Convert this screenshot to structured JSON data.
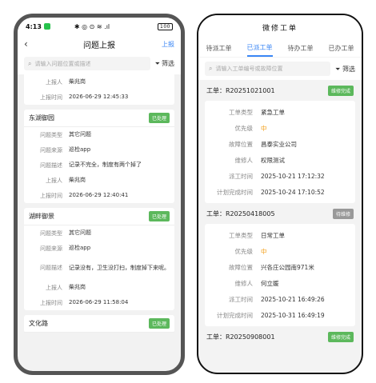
{
  "left": {
    "status": {
      "time": "4:13",
      "right": "✱ ◎ ⊙ ≋ .ıl",
      "battery": "100"
    },
    "nav": {
      "title": "问题上报",
      "action": "上报"
    },
    "search": {
      "placeholder": "请输入问题位置或描述",
      "filter": "筛选"
    },
    "top_partial": {
      "rows": [
        {
          "k": "上报人",
          "v": "柴兆岗"
        },
        {
          "k": "上报时间",
          "v": "2026-06-29 12:45:33"
        }
      ]
    },
    "cards": [
      {
        "name": "东湖御园",
        "status": "已处理",
        "rows": [
          {
            "k": "问题类型",
            "v": "其它问题"
          },
          {
            "k": "问题来源",
            "v": "巡检app"
          },
          {
            "k": "问题描述",
            "v": "记录不完全，制度有两个掉了"
          },
          {
            "k": "上报人",
            "v": "柴兆岗"
          },
          {
            "k": "上报时间",
            "v": "2026-06-29 12:40:41"
          }
        ]
      },
      {
        "name": "湖畔御景",
        "status": "已处理",
        "rows": [
          {
            "k": "问题类型",
            "v": "其它问题"
          },
          {
            "k": "问题来源",
            "v": "巡检app"
          },
          {
            "k": "问题描述",
            "v": "记录没有，卫生没打扫，制度掉下来呢。"
          },
          {
            "k": "上报人",
            "v": "柴兆岗"
          },
          {
            "k": "上报时间",
            "v": "2026-06-29 11:58:04"
          }
        ]
      },
      {
        "name": "文化路",
        "status": "已处理",
        "rows": []
      }
    ]
  },
  "right": {
    "title": "微修工单",
    "tabs": [
      "待派工单",
      "已派工单",
      "待办工单",
      "已办工单"
    ],
    "active_tab": 1,
    "search": {
      "placeholder": "请输入工单编号或故障位置",
      "filter": "筛选"
    },
    "orders": [
      {
        "id": "工单：R20251021001",
        "status": "维修完成",
        "status_kind": "green",
        "rows": [
          {
            "k": "工单类型",
            "v": "紧急工单"
          },
          {
            "k": "优先级",
            "v": "中",
            "orange": true
          },
          {
            "k": "故障位置",
            "v": "昌泰实业公司"
          },
          {
            "k": "维修人",
            "v": "权限测试"
          },
          {
            "k": "派工时间",
            "v": "2025-10-21 17:12:32"
          },
          {
            "k": "计划完成时间",
            "v": "2025-10-24 17:10:52"
          }
        ]
      },
      {
        "id": "工单：R20250418005",
        "status": "待维修",
        "status_kind": "gray",
        "rows": [
          {
            "k": "工单类型",
            "v": "日常工单"
          },
          {
            "k": "优先级",
            "v": "中",
            "orange": true
          },
          {
            "k": "故障位置",
            "v": "兴各庄公园南971米"
          },
          {
            "k": "维修人",
            "v": "何立媛"
          },
          {
            "k": "派工时间",
            "v": "2025-10-21 16:49:26"
          },
          {
            "k": "计划完成时间",
            "v": "2025-10-31 16:49:19"
          }
        ]
      },
      {
        "id": "工单：R20250908001",
        "status": "维修完成",
        "status_kind": "green",
        "rows": []
      }
    ]
  }
}
